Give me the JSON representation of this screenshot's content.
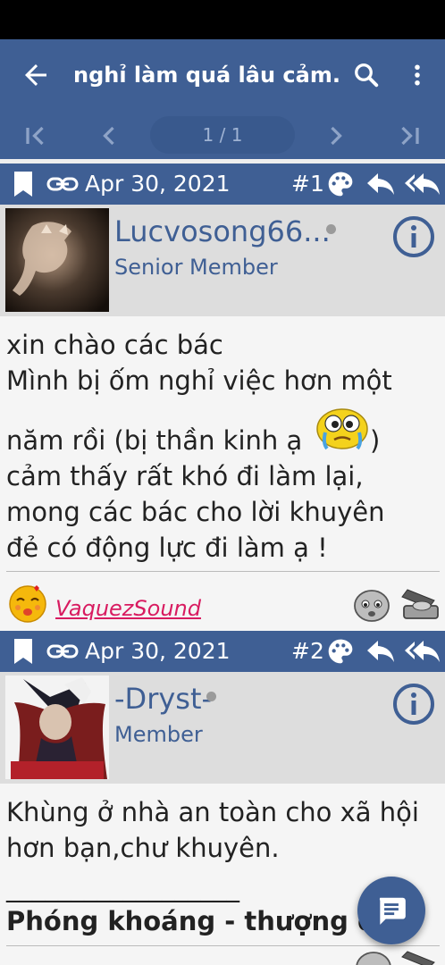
{
  "app": {
    "title": "nghỉ làm quá lâu cảm...",
    "page_indicator": "1 / 1",
    "colors": {
      "primary": "#3f5f94",
      "accent_like": "#d81b60"
    },
    "icons": [
      "back-arrow-icon",
      "search-icon",
      "more-vert-icon",
      "first-page-icon",
      "prev-page-icon",
      "next-page-icon",
      "last-page-icon",
      "chat-icon"
    ]
  },
  "posts": [
    {
      "date": "Apr 30, 2021",
      "number": "#1",
      "username": "Lucvosong66...",
      "role": "Senior Member",
      "lines": [
        "xin chào các bác",
        "Mình bị ốm nghỉ việc hơn một",
        "năm rồi (bị thần kinh ạ",
        ")",
        "cảm thấy rất khó đi làm lại,",
        "mong các bác cho lời khuyên",
        "đẻ có động lực đi làm ạ !"
      ],
      "liker": "VaquezSound"
    },
    {
      "date": "Apr 30, 2021",
      "number": "#2",
      "username": "-Dryst-",
      "role": "Member",
      "lines": [
        "Khùng ở nhà an toàn cho xã hội",
        "hơn bạn,chư khuyên.",
        "__________________",
        "Phóng khoáng - thượng đ"
      ]
    }
  ]
}
